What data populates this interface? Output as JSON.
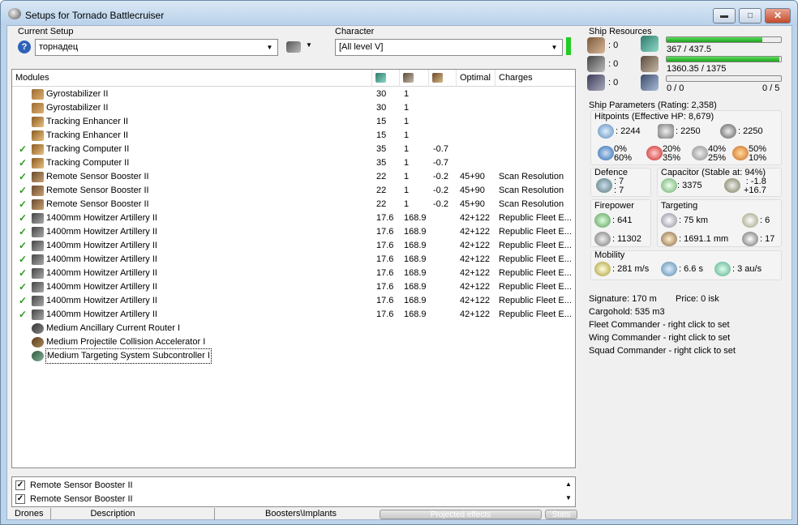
{
  "window": {
    "title": "Setups for Tornado Battlecruiser",
    "min": "▬",
    "max": "□",
    "close": "✕"
  },
  "setup": {
    "label": "Current Setup",
    "value": "торнадец"
  },
  "character": {
    "label": "Character",
    "value": "[All level V]"
  },
  "modules": {
    "headers": [
      "Modules",
      "",
      "",
      "",
      "Optimal",
      "Charges"
    ],
    "header_icons": [
      "cpu-icon",
      "powergrid-icon",
      "capacitor-icon"
    ],
    "rows": [
      {
        "checked": false,
        "icon": "gyrostabilizer-icon",
        "cls": "mi-gyro",
        "name": "Gyrostabilizer II",
        "cpu": "30",
        "pg": "1",
        "cap": "",
        "optimal": "",
        "charges": ""
      },
      {
        "checked": false,
        "icon": "gyrostabilizer-icon",
        "cls": "mi-gyro",
        "name": "Gyrostabilizer II",
        "cpu": "30",
        "pg": "1",
        "cap": "",
        "optimal": "",
        "charges": ""
      },
      {
        "checked": false,
        "icon": "tracking-enhancer-icon",
        "cls": "mi-track",
        "name": "Tracking Enhancer II",
        "cpu": "15",
        "pg": "1",
        "cap": "",
        "optimal": "",
        "charges": ""
      },
      {
        "checked": false,
        "icon": "tracking-enhancer-icon",
        "cls": "mi-track",
        "name": "Tracking Enhancer II",
        "cpu": "15",
        "pg": "1",
        "cap": "",
        "optimal": "",
        "charges": ""
      },
      {
        "checked": true,
        "icon": "tracking-computer-icon",
        "cls": "mi-track",
        "name": "Tracking Computer II",
        "cpu": "35",
        "pg": "1",
        "cap": "-0.7",
        "optimal": "",
        "charges": ""
      },
      {
        "checked": true,
        "icon": "tracking-computer-icon",
        "cls": "mi-track",
        "name": "Tracking Computer II",
        "cpu": "35",
        "pg": "1",
        "cap": "-0.7",
        "optimal": "",
        "charges": ""
      },
      {
        "checked": true,
        "icon": "sensor-booster-icon",
        "cls": "mi-rsb",
        "name": "Remote Sensor Booster II",
        "cpu": "22",
        "pg": "1",
        "cap": "-0.2",
        "optimal": "45+90",
        "charges": "Scan Resolution"
      },
      {
        "checked": true,
        "icon": "sensor-booster-icon",
        "cls": "mi-rsb",
        "name": "Remote Sensor Booster II",
        "cpu": "22",
        "pg": "1",
        "cap": "-0.2",
        "optimal": "45+90",
        "charges": "Scan Resolution"
      },
      {
        "checked": true,
        "icon": "sensor-booster-icon",
        "cls": "mi-rsb",
        "name": "Remote Sensor Booster II",
        "cpu": "22",
        "pg": "1",
        "cap": "-0.2",
        "optimal": "45+90",
        "charges": "Scan Resolution"
      },
      {
        "checked": true,
        "icon": "artillery-icon",
        "cls": "mi-how",
        "name": "1400mm Howitzer Artillery II",
        "cpu": "17.6",
        "pg": "168.9",
        "cap": "",
        "optimal": "42+122",
        "charges": "Republic Fleet E..."
      },
      {
        "checked": true,
        "icon": "artillery-icon",
        "cls": "mi-how",
        "name": "1400mm Howitzer Artillery II",
        "cpu": "17.6",
        "pg": "168.9",
        "cap": "",
        "optimal": "42+122",
        "charges": "Republic Fleet E..."
      },
      {
        "checked": true,
        "icon": "artillery-icon",
        "cls": "mi-how",
        "name": "1400mm Howitzer Artillery II",
        "cpu": "17.6",
        "pg": "168.9",
        "cap": "",
        "optimal": "42+122",
        "charges": "Republic Fleet E..."
      },
      {
        "checked": true,
        "icon": "artillery-icon",
        "cls": "mi-how",
        "name": "1400mm Howitzer Artillery II",
        "cpu": "17.6",
        "pg": "168.9",
        "cap": "",
        "optimal": "42+122",
        "charges": "Republic Fleet E..."
      },
      {
        "checked": true,
        "icon": "artillery-icon",
        "cls": "mi-how",
        "name": "1400mm Howitzer Artillery II",
        "cpu": "17.6",
        "pg": "168.9",
        "cap": "",
        "optimal": "42+122",
        "charges": "Republic Fleet E..."
      },
      {
        "checked": true,
        "icon": "artillery-icon",
        "cls": "mi-how",
        "name": "1400mm Howitzer Artillery II",
        "cpu": "17.6",
        "pg": "168.9",
        "cap": "",
        "optimal": "42+122",
        "charges": "Republic Fleet E..."
      },
      {
        "checked": true,
        "icon": "artillery-icon",
        "cls": "mi-how",
        "name": "1400mm Howitzer Artillery II",
        "cpu": "17.6",
        "pg": "168.9",
        "cap": "",
        "optimal": "42+122",
        "charges": "Republic Fleet E..."
      },
      {
        "checked": true,
        "icon": "artillery-icon",
        "cls": "mi-how",
        "name": "1400mm Howitzer Artillery II",
        "cpu": "17.6",
        "pg": "168.9",
        "cap": "",
        "optimal": "42+122",
        "charges": "Republic Fleet E..."
      },
      {
        "checked": false,
        "icon": "rig-icon",
        "cls": "mi-rig1",
        "name": "Medium Ancillary Current Router I",
        "cpu": "",
        "pg": "",
        "cap": "",
        "optimal": "",
        "charges": ""
      },
      {
        "checked": false,
        "icon": "rig-icon",
        "cls": "mi-rig2",
        "name": "Medium Projectile Collision Accelerator I",
        "cpu": "",
        "pg": "",
        "cap": "",
        "optimal": "",
        "charges": ""
      },
      {
        "checked": false,
        "icon": "rig-icon",
        "cls": "mi-rig3",
        "name": "Medium Targeting System Subcontroller I",
        "cpu": "",
        "pg": "",
        "cap": "",
        "optimal": "",
        "charges": "",
        "focused": true
      }
    ]
  },
  "projected": {
    "items": [
      "Remote Sensor Booster II",
      "Remote Sensor Booster II"
    ]
  },
  "tabs": {
    "drones": "Drones",
    "description": "Description",
    "boosters": "Boosters\\Implants",
    "projected": "Projected effects",
    "stats": "Stats"
  },
  "resources": {
    "title": "Ship Resources",
    "turrets": ": 0",
    "launchers": ": 0",
    "drones": ": 0",
    "cpu_text": "367 / 437.5",
    "cpu_fraction": 0.839,
    "pg_text": "1360.35 / 1375",
    "pg_fraction": 0.989,
    "dronebay_text": "0 / 0",
    "dronebw_text": "0 / 5",
    "drone_fraction": 0
  },
  "params": {
    "title": "Ship Parameters (Rating: 2,358)",
    "hitpoints_title": "Hitpoints (Effective HP: 8,679)",
    "shield_hp": ": 2244",
    "armor_hp": ": 2250",
    "hull_hp": ": 2250",
    "res_em": "0%",
    "res_em2": "60%",
    "res_th": "20%",
    "res_th2": "35%",
    "res_ki": "40%",
    "res_ki2": "25%",
    "res_ex": "50%",
    "res_ex2": "10%",
    "defence_title": "Defence",
    "def1": ": 7",
    "def2": ": 7",
    "cap_title": "Capacitor (Stable at: 94%)",
    "cap_amount": ": 3375",
    "cap_delta1": ": -1.8",
    "cap_delta2": "+16.7",
    "firepower_title": "Firepower",
    "dps": ": 641",
    "volley": ": 11302",
    "targeting_title": "Targeting",
    "range": ": 75 km",
    "maxtargets": ": 6",
    "scanres": ": 1691.1 mm",
    "sensor": ": 17",
    "mobility_title": "Mobility",
    "speed": ": 281 m/s",
    "align": ": 6.6 s",
    "warp": ": 3 au/s",
    "signature": "Signature: 170 m",
    "price": "Price: 0 isk",
    "cargo": "Cargohold: 535 m3",
    "fleet": "Fleet Commander - right click to set",
    "wing": "Wing Commander - right click to set",
    "squad": "Squad Commander - right click to set"
  },
  "colors": {
    "accent_green": "#1f9f1f",
    "check_green": "#2b9a1f",
    "title_bg": "#bcd3e9"
  }
}
